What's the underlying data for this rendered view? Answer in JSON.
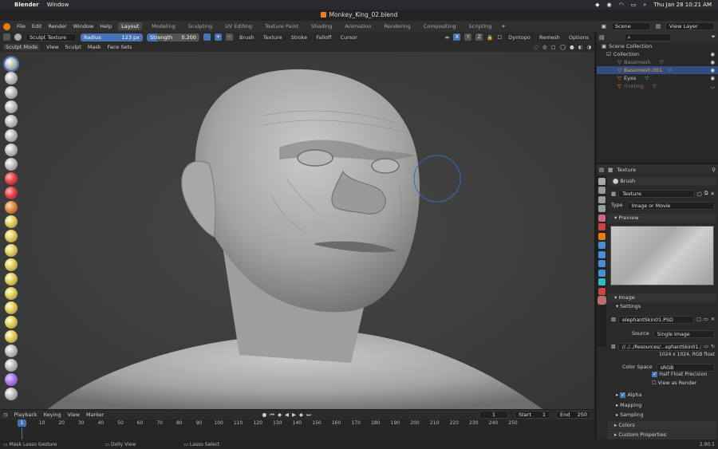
{
  "mac_menubar": {
    "app": "Blender",
    "menu": [
      "Window"
    ],
    "clock": "Thu Jan 28  10:21 AM"
  },
  "window": {
    "title": "Monkey_King_02.blend"
  },
  "topbar": {
    "menus": [
      "File",
      "Edit",
      "Render",
      "Window",
      "Help"
    ],
    "workspaces": [
      "Layout",
      "Modeling",
      "Sculpting",
      "UV Editing",
      "Texture Paint",
      "Shading",
      "Animation",
      "Rendering",
      "Compositing",
      "Scripting"
    ],
    "active_workspace": "Layout",
    "add_tab": "+",
    "scene": "Scene",
    "view_layer": "View Layer"
  },
  "tool_header": {
    "brush_name": "Sculpt Texture",
    "radius_label": "Radius",
    "radius_value": "123 px",
    "strength_label": "Strength",
    "strength_value": "0.200",
    "minus": "−",
    "plus": "+",
    "menus": [
      "Brush",
      "Texture",
      "Stroke",
      "Falloff",
      "Cursor"
    ],
    "axes": [
      "X",
      "Y",
      "Z"
    ],
    "dyntopo": "Dyntopo",
    "remesh": "Remesh",
    "options": "Options"
  },
  "mode_header": {
    "mode": "Sculpt Mode",
    "menus": [
      "View",
      "Sculpt",
      "Mask",
      "Face Sets"
    ]
  },
  "outliner": {
    "root": "Scene Collection",
    "items": [
      {
        "label": "Collection",
        "selected": false
      },
      {
        "label": "Basemesh",
        "selected": false
      },
      {
        "label": "Basemesh.001",
        "selected": true
      },
      {
        "label": "Eyes",
        "selected": false
      },
      {
        "label": "riveting",
        "selected": false
      }
    ]
  },
  "properties": {
    "header": "Texture",
    "context": "Brush",
    "texture_name": "Texture",
    "type_label": "Type",
    "type_value": "Image or Movie",
    "preview_label": "Preview",
    "image_label": "Image",
    "settings_label": "Settings",
    "image_name": "elephantSkin01.PSD",
    "source_label": "Source",
    "source_value": "Single Image",
    "filepath": "//../../Resources/...ephantSkin01.PSD",
    "resolution": "1024 x 1024,  RGB float",
    "color_space_label": "Color Space",
    "color_space_value": "sRGB",
    "half_float": "Half Float Precision",
    "view_as_render": "View as Render",
    "alpha": "Alpha",
    "mapping": "Mapping",
    "sampling": "Sampling",
    "colors": "Colors",
    "custom_properties": "Custom Properties"
  },
  "timeline": {
    "menus": [
      "Playback",
      "Keying",
      "View",
      "Marker"
    ],
    "current_frame": "1",
    "start_label": "Start",
    "start_value": "1",
    "end_label": "End",
    "end_value": "250",
    "ticks": [
      "1",
      "10",
      "20",
      "30",
      "40",
      "50",
      "60",
      "70",
      "80",
      "90",
      "100",
      "110",
      "120",
      "130",
      "140",
      "150",
      "160",
      "170",
      "180",
      "190",
      "200",
      "210",
      "220",
      "230",
      "240",
      "250"
    ]
  },
  "status": {
    "left": "Mask Lasso Gesture",
    "middle": "Dolly View",
    "right": "Lasso Select",
    "version": "2.90.1"
  }
}
